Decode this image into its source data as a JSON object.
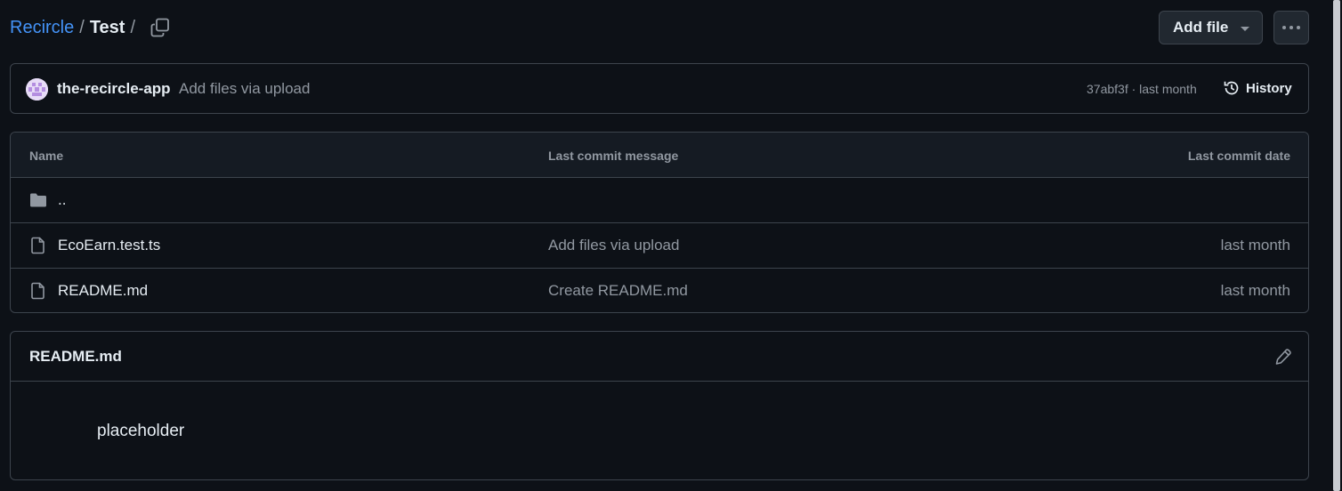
{
  "breadcrumb": {
    "repo": "Recircle",
    "separator": "/",
    "folder": "Test",
    "trailing": "/"
  },
  "header": {
    "add_file_label": "Add file",
    "copy_icon": "copy-icon",
    "more_icon": "kebab-horizontal-icon"
  },
  "commit": {
    "author": "the-recircle-app",
    "message": "Add files via upload",
    "meta": "37abf3f · last month",
    "history_label": "History"
  },
  "table": {
    "headers": {
      "name": "Name",
      "message": "Last commit message",
      "date": "Last commit date"
    },
    "rows": [
      {
        "name": "..",
        "type": "folder",
        "message": "",
        "date": ""
      },
      {
        "name": "EcoEarn.test.ts",
        "type": "file",
        "message": "Add files via upload",
        "date": "last month"
      },
      {
        "name": "README.md",
        "type": "file",
        "message": "Create README.md",
        "date": "last month"
      }
    ]
  },
  "readme": {
    "title": "README.md",
    "content": "placeholder"
  },
  "colors": {
    "background": "#0d1117",
    "border": "#3d444d",
    "link": "#4493f8",
    "muted": "#9198a1",
    "text": "#e6edf3"
  }
}
